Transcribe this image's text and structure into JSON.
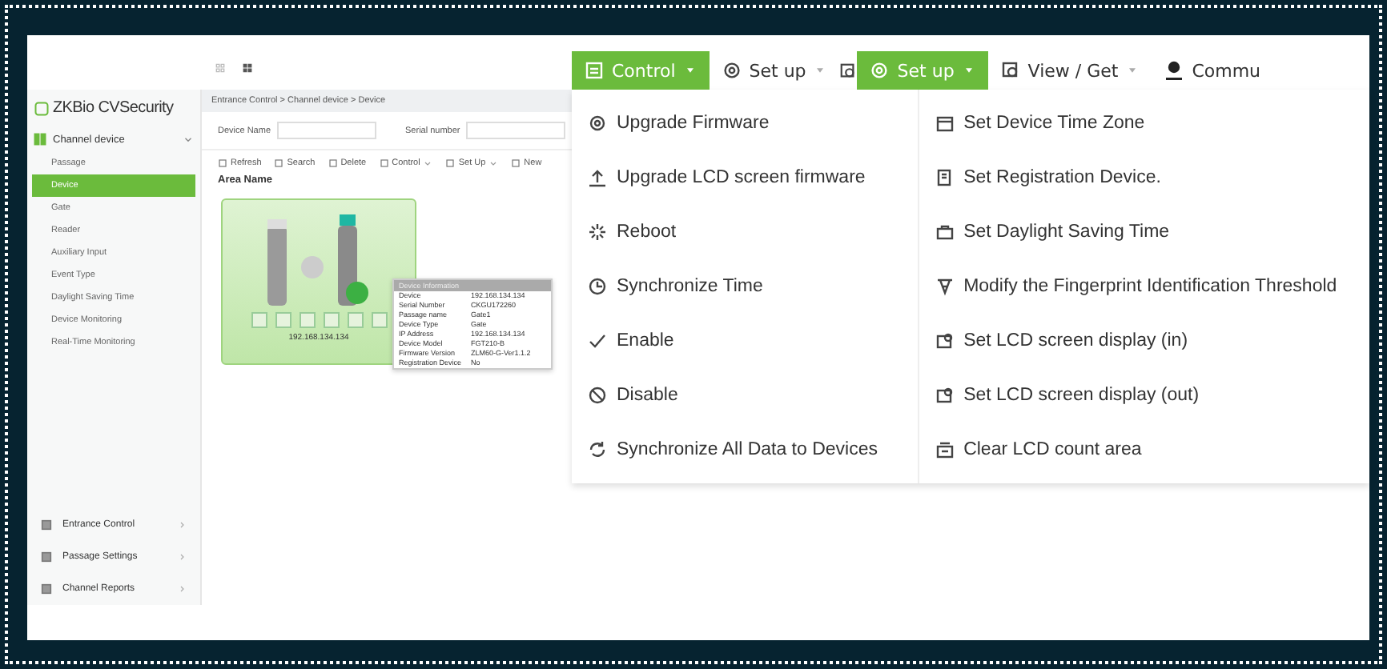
{
  "logo": "ZKBio CVSecurity",
  "sidebar": {
    "group": {
      "label": "Channel device",
      "expanded": true,
      "items": [
        {
          "label": "Passage",
          "selected": false
        },
        {
          "label": "Device",
          "selected": true
        },
        {
          "label": "Gate",
          "selected": false
        },
        {
          "label": "Reader",
          "selected": false
        },
        {
          "label": "Auxiliary Input",
          "selected": false
        },
        {
          "label": "Event Type",
          "selected": false
        },
        {
          "label": "Daylight Saving Time",
          "selected": false
        },
        {
          "label": "Device Monitoring",
          "selected": false
        },
        {
          "label": "Real-Time Monitoring",
          "selected": false
        }
      ]
    },
    "modules": [
      {
        "label": "Entrance Control"
      },
      {
        "label": "Passage Settings"
      },
      {
        "label": "Channel Reports"
      }
    ]
  },
  "breadcrumb": "Entrance Control > Channel device > Device",
  "filters": [
    {
      "label": "Device Name"
    },
    {
      "label": "Serial number"
    }
  ],
  "toolbar": [
    {
      "label": "Refresh",
      "has_menu": false
    },
    {
      "label": "Search",
      "has_menu": false
    },
    {
      "label": "Delete",
      "has_menu": false
    },
    {
      "label": "Control",
      "has_menu": true
    },
    {
      "label": "Set Up",
      "has_menu": true
    },
    {
      "label": "New",
      "has_menu": false
    }
  ],
  "area_title": "Area Name",
  "device": {
    "ip": "192.168.134.134",
    "online": true,
    "tooltip": {
      "title": "Device Information",
      "rows": [
        {
          "label": "Device",
          "value": "192.168.134.134"
        },
        {
          "label": "Serial Number",
          "value": "CKGU172260"
        },
        {
          "label": "Passage name",
          "value": "Gate1"
        },
        {
          "label": "Device Type",
          "value": "Gate"
        },
        {
          "label": "IP Address",
          "value": "192.168.134.134"
        },
        {
          "label": "Device Model",
          "value": "FGT210-B"
        },
        {
          "label": "Firmware Version",
          "value": "ZLM60-G-Ver1.1.2"
        },
        {
          "label": "Registration Device",
          "value": "No"
        }
      ]
    }
  },
  "menu_bar": [
    {
      "label": "Control",
      "selected": true
    },
    {
      "label": "Set up",
      "selected": false
    },
    {
      "label": "Set up",
      "selected": true
    },
    {
      "label": "View / Get",
      "selected": false
    },
    {
      "label": "Commu",
      "selected": false
    }
  ],
  "menus": [
    {
      "items": [
        "Upgrade Firmware",
        "Upgrade LCD screen firmware",
        "Reboot",
        "Synchronize Time",
        "Enable",
        "Disable",
        "Synchronize All Data to Devices"
      ]
    },
    {
      "items": [
        "Set Device Time Zone",
        "Set Registration Device.",
        "Set Daylight Saving Time",
        "Modify the Fingerprint Identification Threshold",
        "Set LCD screen display (in)",
        "Set LCD screen display (out)",
        "Clear LCD count area"
      ]
    }
  ]
}
